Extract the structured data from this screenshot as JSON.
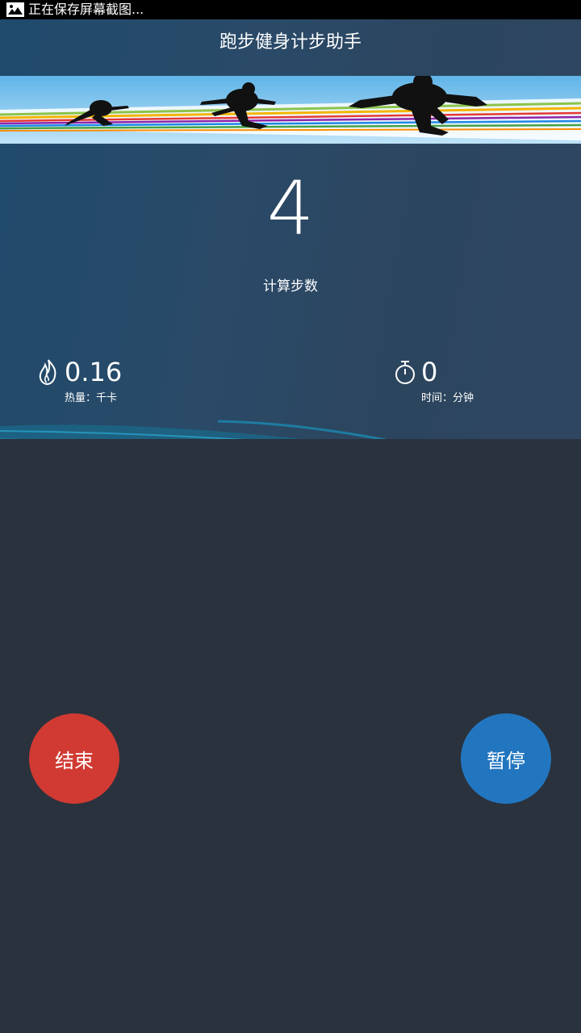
{
  "status_bar": {
    "icon": "image-icon",
    "text": "正在保存屏幕截图..."
  },
  "header": {
    "title": "跑步健身计步助手"
  },
  "main": {
    "steps": "4",
    "steps_label": "计算步数",
    "calories": {
      "icon": "flame-icon",
      "value": "0.16",
      "unit": "热量：千卡"
    },
    "time": {
      "icon": "stopwatch-icon",
      "value": "0",
      "unit": "时间：分钟"
    }
  },
  "actions": {
    "end_label": "结束",
    "pause_label": "暂停"
  },
  "colors": {
    "background": "#2a323d",
    "hero": "#2a4a68",
    "end_button": "#d03a32",
    "pause_button": "#2276c0"
  }
}
